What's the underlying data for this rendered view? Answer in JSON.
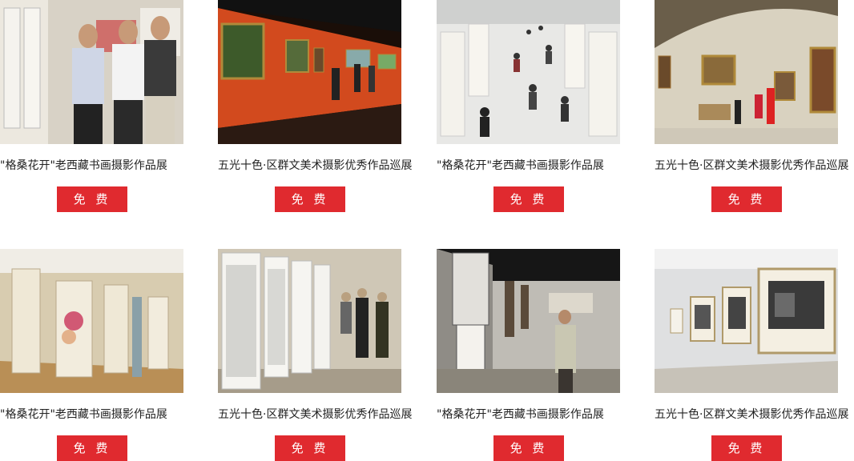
{
  "cards": [
    {
      "title": "\"格桑花开\"老西藏书画摄影作品展",
      "button": "免 费"
    },
    {
      "title": "五光十色·区群文美术摄影优秀作品巡展",
      "button": "免 费"
    },
    {
      "title": "\"格桑花开\"老西藏书画摄影作品展",
      "button": "免 费"
    },
    {
      "title": "五光十色·区群文美术摄影优秀作品巡展",
      "button": "免 费"
    },
    {
      "title": "\"格桑花开\"老西藏书画摄影作品展",
      "button": "免 费"
    },
    {
      "title": "五光十色·区群文美术摄影优秀作品巡展",
      "button": "免 费"
    },
    {
      "title": "\"格桑花开\"老西藏书画摄影作品展",
      "button": "免 费"
    },
    {
      "title": "五光十色·区群文美术摄影优秀作品巡展",
      "button": "免 费"
    }
  ],
  "colors": {
    "button_bg": "#e02a2f",
    "button_text": "#ffffff",
    "title_text": "#222222"
  }
}
